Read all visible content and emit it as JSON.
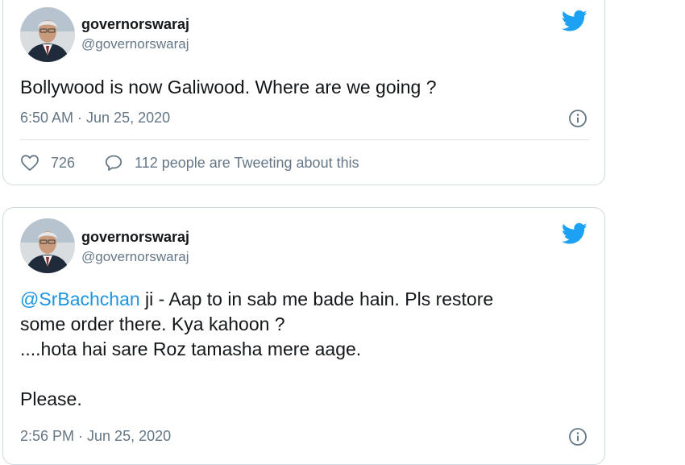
{
  "tweets": [
    {
      "name": "governorswaraj",
      "handle": "@governorswaraj",
      "text": "Bollywood is now Galiwood. Where are we going ?",
      "time": "6:50 AM · Jun 25, 2020",
      "likes": "726",
      "tweeting": "112 people are Tweeting about this"
    },
    {
      "name": "governorswaraj",
      "handle": "@governorswaraj",
      "mention": "@SrBachchan",
      "text": " ji - Aap to in sab me bade hain. Pls restore\nsome order there. Kya kahoon ?\n....hota hai sare Roz tamasha mere aage.\n\nPlease.",
      "time": "2:56 PM · Jun 25, 2020"
    }
  ],
  "icons": {
    "brand": "twitter-bird-icon",
    "info": "info-icon",
    "like": "heart-icon",
    "reply": "speech-bubble-icon"
  },
  "colors": {
    "brand": "#1da1f2",
    "link": "#1b95e0",
    "secondary_text": "#657786",
    "border": "#cfd9de"
  }
}
